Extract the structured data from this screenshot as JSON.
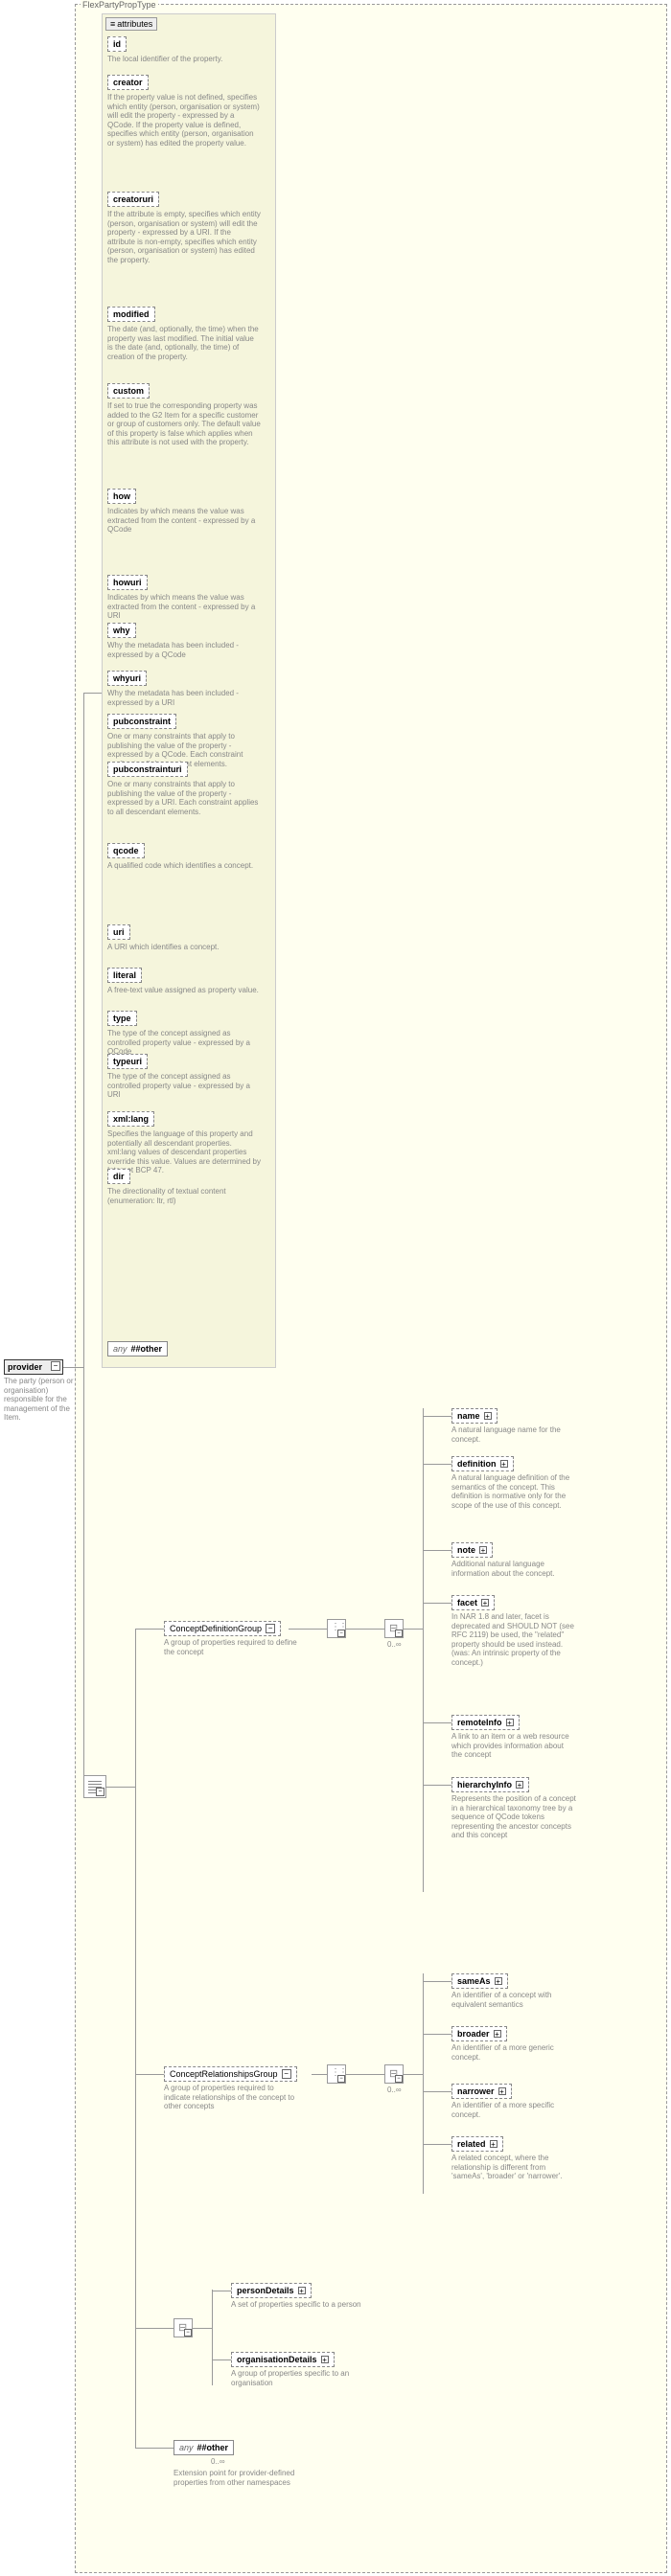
{
  "root": {
    "type_label": "FlexPartyPropType"
  },
  "provider": {
    "name": "provider",
    "desc": "The party (person or organisation) responsible for the management of the Item."
  },
  "attributes": {
    "header": "attributes",
    "items": [
      {
        "name": "id",
        "desc": "The local identifier of the property."
      },
      {
        "name": "creator",
        "desc": "If the property value is not defined, specifies which entity (person, organisation or system) will edit the property - expressed by a QCode. If the property value is defined, specifies which entity (person, organisation or system) has edited the property value."
      },
      {
        "name": "creatoruri",
        "desc": "If the attribute is empty, specifies which entity (person, organisation or system) will edit the property - expressed by a URI. If the attribute is non-empty, specifies which entity (person, organisation or system) has edited the property."
      },
      {
        "name": "modified",
        "desc": "The date (and, optionally, the time) when the property was last modified. The initial value is the date (and, optionally, the time) of creation of the property."
      },
      {
        "name": "custom",
        "desc": "If set to true the corresponding property was added to the G2 Item for a specific customer or group of customers only. The default value of this property is false which applies when this attribute is not used with the property."
      },
      {
        "name": "how",
        "desc": "Indicates by which means the value was extracted from the content - expressed by a QCode"
      },
      {
        "name": "howuri",
        "desc": "Indicates by which means the value was extracted from the content - expressed by a URI"
      },
      {
        "name": "why",
        "desc": "Why the metadata has been included - expressed by a QCode"
      },
      {
        "name": "whyuri",
        "desc": "Why the metadata has been included - expressed by a URI"
      },
      {
        "name": "pubconstraint",
        "desc": "One or many constraints that apply to publishing the value of the property - expressed by a QCode. Each constraint applies to all descendant elements."
      },
      {
        "name": "pubconstrainturi",
        "desc": "One or many constraints that apply to publishing the value of the property - expressed by a URI. Each constraint applies to all descendant elements."
      },
      {
        "name": "qcode",
        "desc": "A qualified code which identifies a concept."
      },
      {
        "name": "uri",
        "desc": "A URI which identifies a concept."
      },
      {
        "name": "literal",
        "desc": "A free-text value assigned as property value."
      },
      {
        "name": "type",
        "desc": "The type of the concept assigned as controlled property value - expressed by a QCode"
      },
      {
        "name": "typeuri",
        "desc": "The type of the concept assigned as controlled property value - expressed by a URI"
      },
      {
        "name": "xml:lang",
        "desc": "Specifies the language of this property and potentially all descendant properties. xml:lang values of descendant properties override this value. Values are determined by Internet BCP 47."
      },
      {
        "name": "dir",
        "desc": "The directionality of textual content (enumeration: ltr, rtl)"
      }
    ],
    "any": {
      "label": "any",
      "val": "##other"
    }
  },
  "groups": {
    "cdg": {
      "name": "ConceptDefinitionGroup",
      "desc": "A group of properties required to define the concept"
    },
    "crg": {
      "name": "ConceptRelationshipsGroup",
      "desc": "A group of properties required to indicate relationships of the concept to other concepts"
    }
  },
  "cdg_items": [
    {
      "name": "name",
      "desc": "A natural language name for the concept."
    },
    {
      "name": "definition",
      "desc": "A natural language definition of the semantics of the concept. This definition is normative only for the scope of the use of this concept."
    },
    {
      "name": "note",
      "desc": "Additional natural language information about the concept."
    },
    {
      "name": "facet",
      "desc": "In NAR 1.8 and later, facet is deprecated and SHOULD NOT (see RFC 2119) be used, the \"related\" property should be used instead.(was: An intrinsic property of the concept.)"
    },
    {
      "name": "remoteInfo",
      "desc": "A link to an item or a web resource which provides information about the concept"
    },
    {
      "name": "hierarchyInfo",
      "desc": "Represents the position of a concept in a hierarchical taxonomy tree by a sequence of QCode tokens representing the ancestor concepts and this concept"
    }
  ],
  "crg_items": [
    {
      "name": "sameAs",
      "desc": "An identifier of a concept with equivalent semantics"
    },
    {
      "name": "broader",
      "desc": "An identifier of a more generic concept."
    },
    {
      "name": "narrower",
      "desc": "An identifier of a more specific concept."
    },
    {
      "name": "related",
      "desc": "A related concept, where the relationship is different from 'sameAs', 'broader' or 'narrower'."
    }
  ],
  "choice_items": [
    {
      "name": "personDetails",
      "desc": "A set of properties specific to a person"
    },
    {
      "name": "organisationDetails",
      "desc": "A group of properties specific to an organisation"
    }
  ],
  "any_bottom": {
    "label": "any",
    "val": "##other",
    "card": "0..∞",
    "desc": "Extension point for provider-defined properties from other namespaces"
  },
  "cardinality": "0..∞"
}
